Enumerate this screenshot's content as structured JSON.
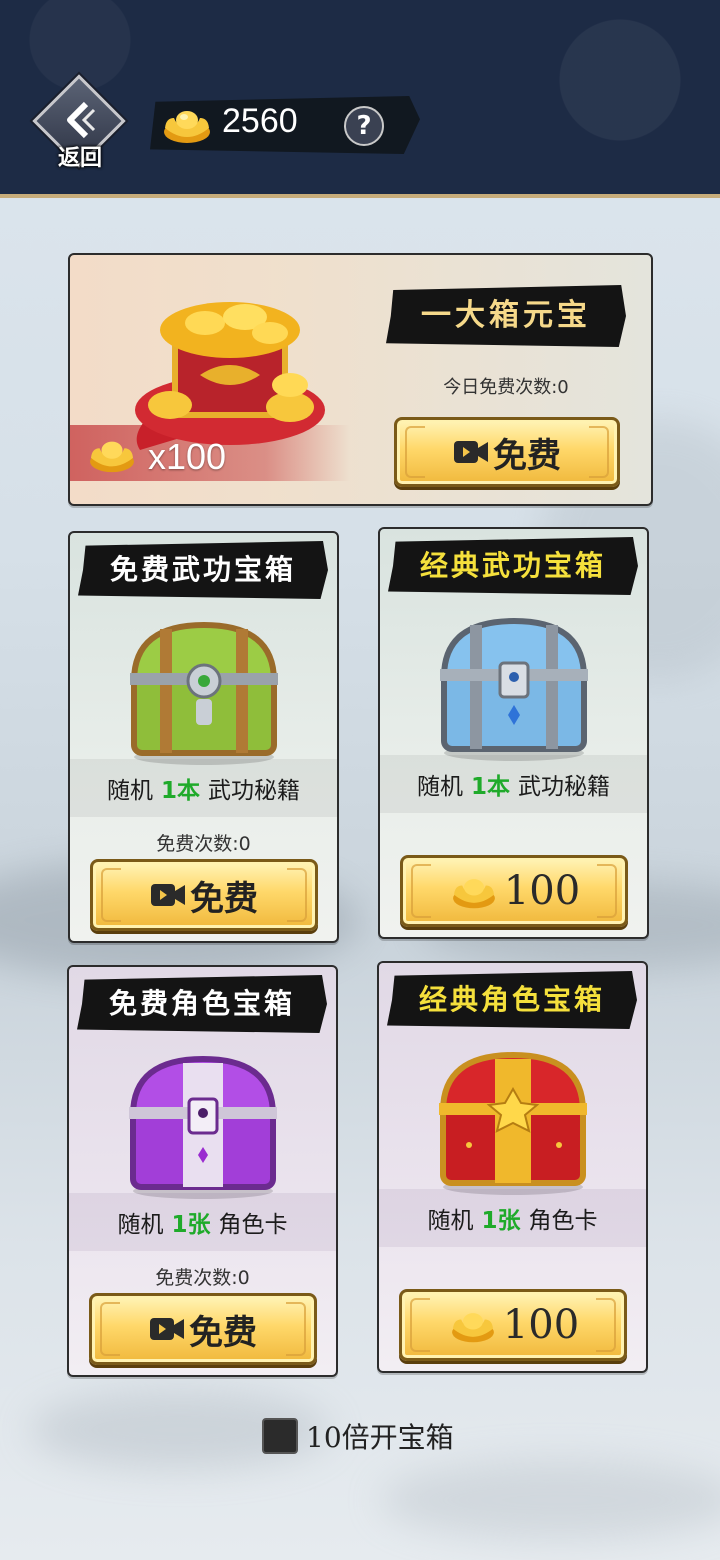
{
  "header": {
    "back_label": "返回",
    "currency_value": "2560",
    "help_label": "?"
  },
  "featured": {
    "title": "一大箱元宝",
    "subtext": "今日免费次数:0",
    "amount": "x100",
    "button_label": "免费"
  },
  "cards": [
    {
      "title": "免费武功宝箱",
      "info_prefix": "随机",
      "info_count": "1本",
      "info_suffix": "武功秘籍",
      "free_count": "免费次数:0",
      "button_label": "免费"
    },
    {
      "title": "经典武功宝箱",
      "info_prefix": "随机",
      "info_count": "1本",
      "info_suffix": "武功秘籍",
      "price": "100"
    },
    {
      "title": "免费角色宝箱",
      "info_prefix": "随机",
      "info_count": "1张",
      "info_suffix": "角色卡",
      "free_count": "免费次数:0",
      "button_label": "免费"
    },
    {
      "title": "经典角色宝箱",
      "info_prefix": "随机",
      "info_count": "1张",
      "info_suffix": "角色卡",
      "price": "100"
    }
  ],
  "ten_x": {
    "label": "10倍开宝箱"
  },
  "colors": {
    "header_bg": "#1d2b45",
    "gold_button": "#ffd86a",
    "highlight_green": "#1faa2a",
    "premium_title": "#f5e03c"
  },
  "icons": [
    "back-arrow-icon",
    "gold-ingot-icon",
    "help-icon",
    "video-icon",
    "treasure-chest-icon"
  ]
}
